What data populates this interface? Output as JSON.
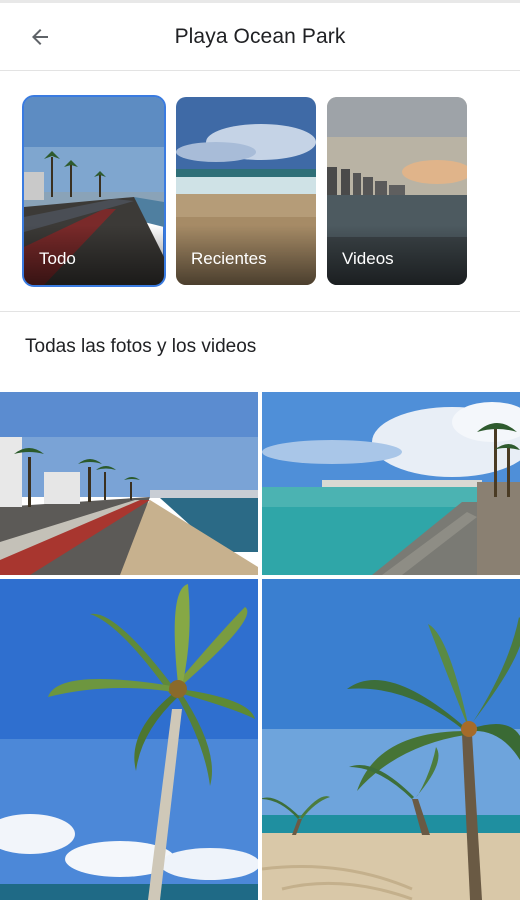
{
  "header": {
    "title": "Playa Ocean Park",
    "back_icon": "arrow-back-icon"
  },
  "albums": [
    {
      "label": "Todo",
      "selected": true
    },
    {
      "label": "Recientes",
      "selected": false
    },
    {
      "label": "Videos",
      "selected": false
    }
  ],
  "section": {
    "title": "Todas las fotos y los videos"
  },
  "colors": {
    "accent": "#3a7be0",
    "sky": "#3b7fd4",
    "sea": "#2c9aa0"
  }
}
